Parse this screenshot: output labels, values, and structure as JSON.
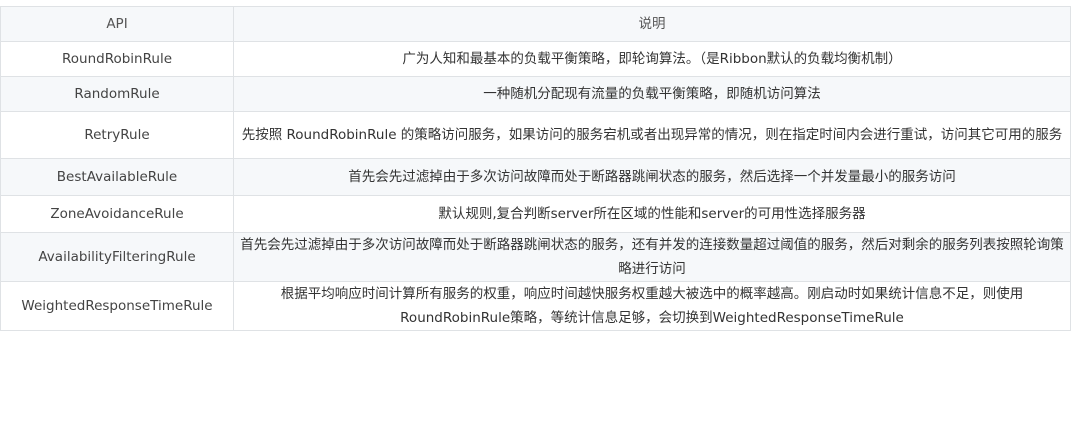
{
  "table": {
    "headers": [
      "API",
      "说明"
    ],
    "rows": [
      {
        "api": "RoundRobinRule",
        "desc": "广为人知和最基本的负载平衡策略，即轮询算法。（是Ribbon默认的负载均衡机制）"
      },
      {
        "api": "RandomRule",
        "desc": "一种随机分配现有流量的负载平衡策略，即随机访问算法"
      },
      {
        "api": "RetryRule",
        "desc": "先按照 RoundRobinRule 的策略访问服务，如果访问的服务宕机或者出现异常的情况，则在指定时间内会进行重试，访问其它可用的服务"
      },
      {
        "api": "BestAvailableRule",
        "desc": "首先会先过滤掉由于多次访问故障而处于断路器跳闸状态的服务，然后选择一个并发量最小的服务访问"
      },
      {
        "api": "ZoneAvoidanceRule",
        "desc": "默认规则,复合判断server所在区域的性能和server的可用性选择服务器"
      },
      {
        "api": "AvailabilityFilteringRule",
        "desc": "首先会先过滤掉由于多次访问故障而处于断路器跳闸状态的服务，还有并发的连接数量超过阈值的服务，然后对剩余的服务列表按照轮询策略进行访问"
      },
      {
        "api": "WeightedResponseTimeRule",
        "desc": "根据平均响应时间计算所有服务的权重，响应时间越快服务权重越大被选中的概率越高。刚启动时如果统计信息不足，则使用RoundRobinRule策略，等统计信息足够，会切换到WeightedResponseTimeRule"
      }
    ]
  }
}
